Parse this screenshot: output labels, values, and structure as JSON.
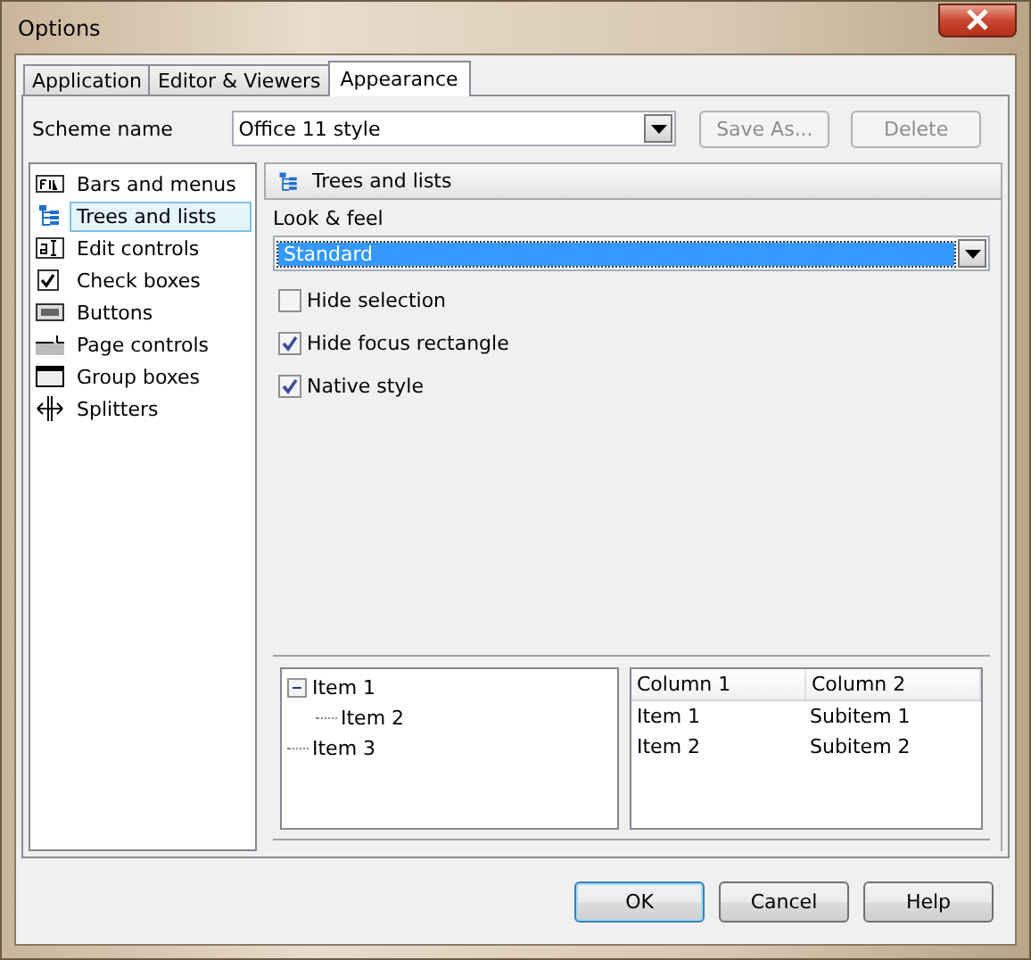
{
  "window": {
    "title": "Options"
  },
  "tabs": [
    {
      "label": "Application",
      "selected": false
    },
    {
      "label": "Editor & Viewers",
      "selected": false
    },
    {
      "label": "Appearance",
      "selected": true
    }
  ],
  "scheme": {
    "label": "Scheme name",
    "value": "Office 11 style",
    "buttons": [
      {
        "label": "Save As...",
        "disabled": true
      },
      {
        "label": "Delete",
        "disabled": true
      }
    ]
  },
  "sidebar": {
    "items": [
      {
        "label": "Bars and menus",
        "selected": false
      },
      {
        "label": "Trees and lists",
        "selected": true
      },
      {
        "label": "Edit controls",
        "selected": false
      },
      {
        "label": "Check boxes",
        "selected": false
      },
      {
        "label": "Buttons",
        "selected": false
      },
      {
        "label": "Page controls",
        "selected": false
      },
      {
        "label": "Group boxes",
        "selected": false
      },
      {
        "label": "Splitters",
        "selected": false
      }
    ]
  },
  "panel": {
    "title": "Trees and lists",
    "look_label": "Look & feel",
    "look_value": "Standard",
    "checkboxes": [
      {
        "label": "Hide selection",
        "checked": false
      },
      {
        "label": "Hide focus rectangle",
        "checked": true
      },
      {
        "label": "Native style",
        "checked": true
      }
    ],
    "tree": [
      {
        "label": "Item 1",
        "expanded": true,
        "children": [
          {
            "label": "Item 2"
          }
        ]
      },
      {
        "label": "Item 3"
      }
    ],
    "list": {
      "columns": [
        "Column 1",
        "Column 2"
      ],
      "rows": [
        [
          "Item 1",
          "Subitem 1"
        ],
        [
          "Item 2",
          "Subitem 2"
        ]
      ]
    }
  },
  "footer": {
    "buttons": [
      {
        "label": "OK",
        "default": true
      },
      {
        "label": "Cancel",
        "default": false
      },
      {
        "label": "Help",
        "default": false
      }
    ]
  }
}
